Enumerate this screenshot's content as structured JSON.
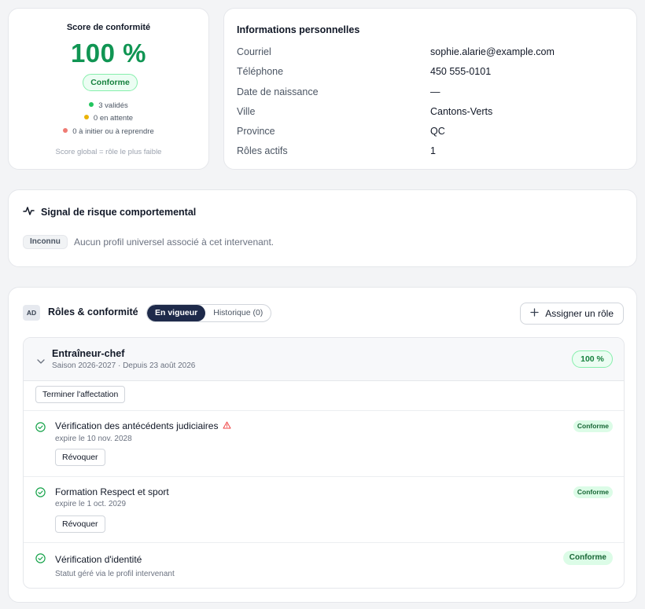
{
  "score": {
    "title": "Score de conformité",
    "value": "100 %",
    "badge": "Conforme",
    "stats": [
      {
        "label": "3 validés",
        "color": "#22c55e"
      },
      {
        "label": "0 en attente",
        "color": "#eab308"
      },
      {
        "label": "0 à initier ou à reprendre",
        "color": "#ef7b74"
      }
    ],
    "note": "Score global = rôle le plus faible"
  },
  "info": {
    "title": "Informations personnelles",
    "rows": [
      {
        "label": "Courriel",
        "value": "sophie.alarie@example.com"
      },
      {
        "label": "Téléphone",
        "value": "450 555-0101"
      },
      {
        "label": "Date de naissance",
        "value": "—"
      },
      {
        "label": "Ville",
        "value": "Cantons-Verts"
      },
      {
        "label": "Province",
        "value": "QC"
      },
      {
        "label": "Rôles actifs",
        "value": "1"
      }
    ]
  },
  "risk": {
    "title": "Signal de risque comportemental",
    "tag": "Inconnu",
    "text": "Aucun profil universel associé à cet intervenant."
  },
  "roles": {
    "initials": "AD",
    "title": "Rôles & conformité",
    "tabs": [
      "En vigueur",
      "Historique (0)"
    ],
    "active_tab": "En vigueur",
    "assign_label": "Assigner un rôle",
    "role": {
      "name": "Entraîneur-chef",
      "subtitle": "Saison 2026-2027 · Depuis 23 août 2026",
      "percent": "100 %",
      "end_label": "Terminer l'affectation",
      "requirements": [
        {
          "title": "Vérification des antécédents judiciaires",
          "sub": "expire le 10 nov. 2028",
          "status": "Conforme",
          "action": "Révoquer",
          "warning": true
        },
        {
          "title": "Formation Respect et sport",
          "sub": "expire le 1 oct. 2029",
          "status": "Conforme",
          "action": "Révoquer",
          "warning": false
        },
        {
          "title": "Vérification d'identité",
          "sub": "Statut géré via le profil intervenant",
          "status": "Conforme",
          "action": "",
          "warning": false
        }
      ]
    }
  },
  "colors": {
    "accent_green": "#109553",
    "navy": "#1e2a4a",
    "warning_red": "#ef4444"
  }
}
